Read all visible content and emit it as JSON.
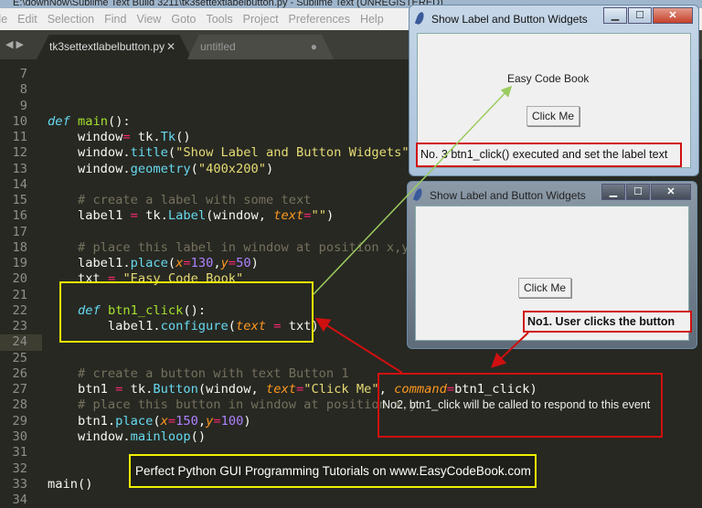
{
  "app": {
    "title": "E:\\downNow\\Sublime Text Build 3211\\tk3settextlabelbutton.py - Sublime Text (UNREGISTERED)",
    "menu": [
      "File",
      "Edit",
      "Selection",
      "Find",
      "View",
      "Goto",
      "Tools",
      "Project",
      "Preferences",
      "Help"
    ],
    "tabs": [
      {
        "label": "tk3settextlabelbutton.py",
        "active": true
      },
      {
        "label": "untitled",
        "active": false,
        "modified": true
      }
    ],
    "current_line": 24
  },
  "code": [
    [
      7,
      []
    ],
    [
      8,
      []
    ],
    [
      9,
      []
    ],
    [
      10,
      [
        [
          "k",
          "def"
        ],
        [
          "t",
          " "
        ],
        [
          "f",
          "main"
        ],
        [
          "t",
          "():"
        ]
      ]
    ],
    [
      11,
      [
        [
          "t",
          "    window"
        ],
        [
          "o",
          "="
        ],
        [
          "t",
          " tk."
        ],
        [
          "m",
          "Tk"
        ],
        [
          "t",
          "()"
        ]
      ]
    ],
    [
      12,
      [
        [
          "t",
          "    window."
        ],
        [
          "m",
          "title"
        ],
        [
          "t",
          "("
        ],
        [
          "s",
          "\"Show Label and Button Widgets\""
        ],
        [
          "t",
          ")"
        ]
      ]
    ],
    [
      13,
      [
        [
          "t",
          "    window."
        ],
        [
          "m",
          "geometry"
        ],
        [
          "t",
          "("
        ],
        [
          "s",
          "\"400x200\""
        ],
        [
          "t",
          ")"
        ]
      ]
    ],
    [
      14,
      []
    ],
    [
      15,
      [
        [
          "c",
          "    # create a label with some text"
        ]
      ]
    ],
    [
      16,
      [
        [
          "t",
          "    label1 "
        ],
        [
          "o",
          "="
        ],
        [
          "t",
          " tk."
        ],
        [
          "m",
          "Label"
        ],
        [
          "t",
          "(window, "
        ],
        [
          "a",
          "text"
        ],
        [
          "o",
          "="
        ],
        [
          "s",
          "\"\""
        ],
        [
          "t",
          ")"
        ]
      ]
    ],
    [
      17,
      []
    ],
    [
      18,
      [
        [
          "c",
          "    # place this label in window at position x,y"
        ]
      ]
    ],
    [
      19,
      [
        [
          "t",
          "    label1."
        ],
        [
          "m",
          "place"
        ],
        [
          "t",
          "("
        ],
        [
          "a",
          "x"
        ],
        [
          "o",
          "="
        ],
        [
          "n",
          "130"
        ],
        [
          "t",
          ","
        ],
        [
          "a",
          "y"
        ],
        [
          "o",
          "="
        ],
        [
          "n",
          "50"
        ],
        [
          "t",
          ")"
        ]
      ]
    ],
    [
      20,
      [
        [
          "t",
          "    txt "
        ],
        [
          "o",
          "="
        ],
        [
          "t",
          " "
        ],
        [
          "s",
          "\"Easy Code Book\""
        ]
      ]
    ],
    [
      21,
      []
    ],
    [
      22,
      [
        [
          "t",
          "    "
        ],
        [
          "k",
          "def"
        ],
        [
          "t",
          " "
        ],
        [
          "f",
          "btn1_click"
        ],
        [
          "t",
          "():"
        ]
      ]
    ],
    [
      23,
      [
        [
          "t",
          "        label1."
        ],
        [
          "m",
          "configure"
        ],
        [
          "t",
          "("
        ],
        [
          "a",
          "text"
        ],
        [
          "t",
          " "
        ],
        [
          "o",
          "="
        ],
        [
          "t",
          " txt)"
        ]
      ]
    ],
    [
      24,
      []
    ],
    [
      25,
      []
    ],
    [
      26,
      [
        [
          "c",
          "    # create a button with text Button 1"
        ]
      ]
    ],
    [
      27,
      [
        [
          "t",
          "    btn1 "
        ],
        [
          "o",
          "="
        ],
        [
          "t",
          " tk."
        ],
        [
          "m",
          "Button"
        ],
        [
          "t",
          "(window, "
        ],
        [
          "a",
          "text"
        ],
        [
          "o",
          "="
        ],
        [
          "s",
          "\"Click Me\""
        ],
        [
          "t",
          ", "
        ],
        [
          "a",
          "command"
        ],
        [
          "o",
          "="
        ],
        [
          "t",
          "btn1_click)"
        ]
      ]
    ],
    [
      28,
      [
        [
          "c",
          "    # place this button in window at position x,y"
        ]
      ]
    ],
    [
      29,
      [
        [
          "t",
          "    btn1."
        ],
        [
          "m",
          "place"
        ],
        [
          "t",
          "("
        ],
        [
          "a",
          "x"
        ],
        [
          "o",
          "="
        ],
        [
          "n",
          "150"
        ],
        [
          "t",
          ","
        ],
        [
          "a",
          "y"
        ],
        [
          "o",
          "="
        ],
        [
          "n",
          "100"
        ],
        [
          "t",
          ")"
        ]
      ]
    ],
    [
      30,
      [
        [
          "t",
          "    window."
        ],
        [
          "m",
          "mainloop"
        ],
        [
          "t",
          "()"
        ]
      ]
    ],
    [
      31,
      []
    ],
    [
      32,
      []
    ],
    [
      33,
      [
        [
          "t",
          "main()"
        ]
      ]
    ],
    [
      34,
      []
    ]
  ],
  "window_after": {
    "title": "Show Label and Button Widgets",
    "label": "Easy Code Book",
    "button": "Click Me"
  },
  "window_before": {
    "title": "Show Label and Button Widgets",
    "button": "Click Me"
  },
  "annotations": {
    "step3": "No. 3 btn1_click() executed and set the label text",
    "step1": "No1. User clicks the button",
    "step2": "No2. btn1_click will be called to respond to this event",
    "banner": "Perfect Python GUI Programming Tutorials on www.EasyCodeBook.com"
  },
  "colors": {
    "annotation_red": "#d01010",
    "highlight_yellow": "#f0f000",
    "arrow_green": "#9ccc60",
    "editor_bg": "#272822"
  }
}
